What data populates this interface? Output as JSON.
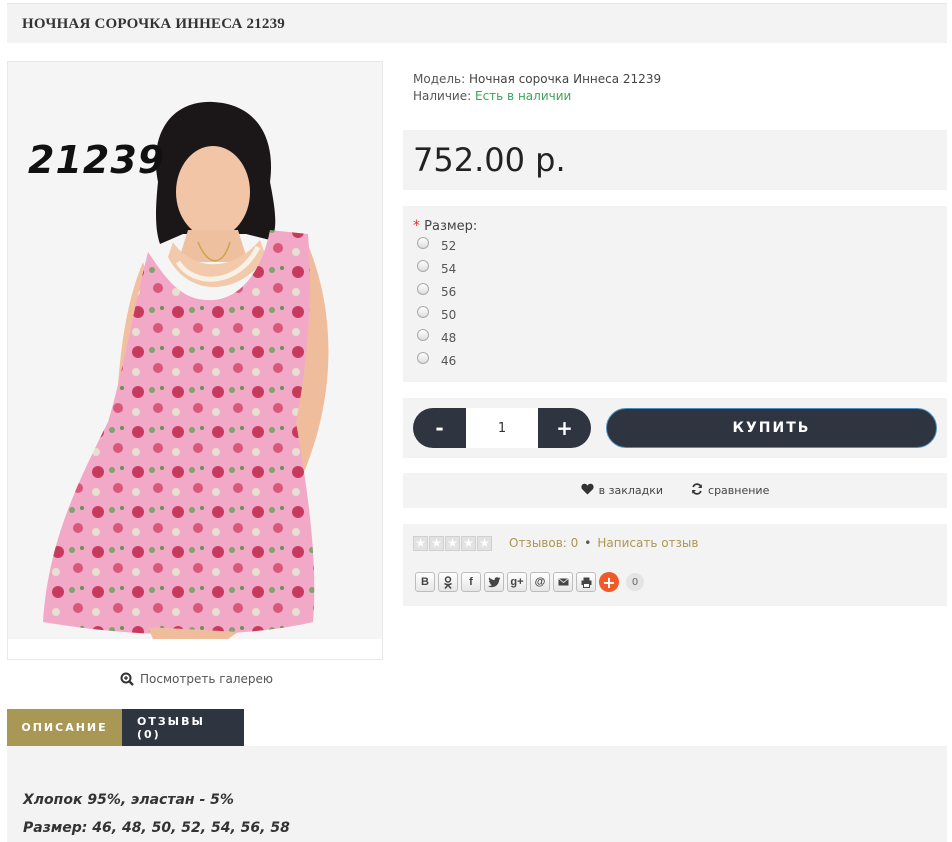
{
  "product": {
    "title": "НОЧНАЯ СОРОЧКА ИННЕСА 21239",
    "photo_code": "21239",
    "model_label": "Модель:",
    "model_value": "Ночная сорочка Иннеса 21239",
    "stock_label": "Наличие:",
    "stock_value": "Есть в наличии",
    "price": "752.00 р."
  },
  "gallery": {
    "label": "Посмотреть галерею"
  },
  "size": {
    "label": "Размер:",
    "required_mark": "*",
    "options": [
      "52",
      "54",
      "56",
      "50",
      "48",
      "46"
    ]
  },
  "cart": {
    "minus": "-",
    "plus": "+",
    "quantity": "1",
    "buy_label": "КУПИТЬ"
  },
  "actions": {
    "wishlist": "в закладки",
    "compare": "сравнение"
  },
  "reviews": {
    "count_label": "Отзывов: 0",
    "separator": "•",
    "write_label": "Написать отзыв",
    "rating": 0,
    "max_rating": 5
  },
  "share": {
    "buttons": [
      "В",
      "ok-icon",
      "f",
      "twitter-icon",
      "g+",
      "@",
      "mail-icon",
      "print-icon"
    ],
    "more": "+",
    "count": "0"
  },
  "tabs": [
    {
      "label": "ОПИСАНИЕ"
    },
    {
      "label": "ОТЗЫВЫ (0)"
    }
  ],
  "description": {
    "line1": "Хлопок 95%, эластан - 5%",
    "line2": "Размер:  46, 48, 50, 52, 54, 56, 58"
  },
  "colors": {
    "accent_gold": "#a99756",
    "dark_navy": "#2f3441",
    "stock_green": "#3aa35b",
    "panel_bg": "#f3f3f3",
    "required_red": "#e03131",
    "share_orange": "#f05a28"
  }
}
